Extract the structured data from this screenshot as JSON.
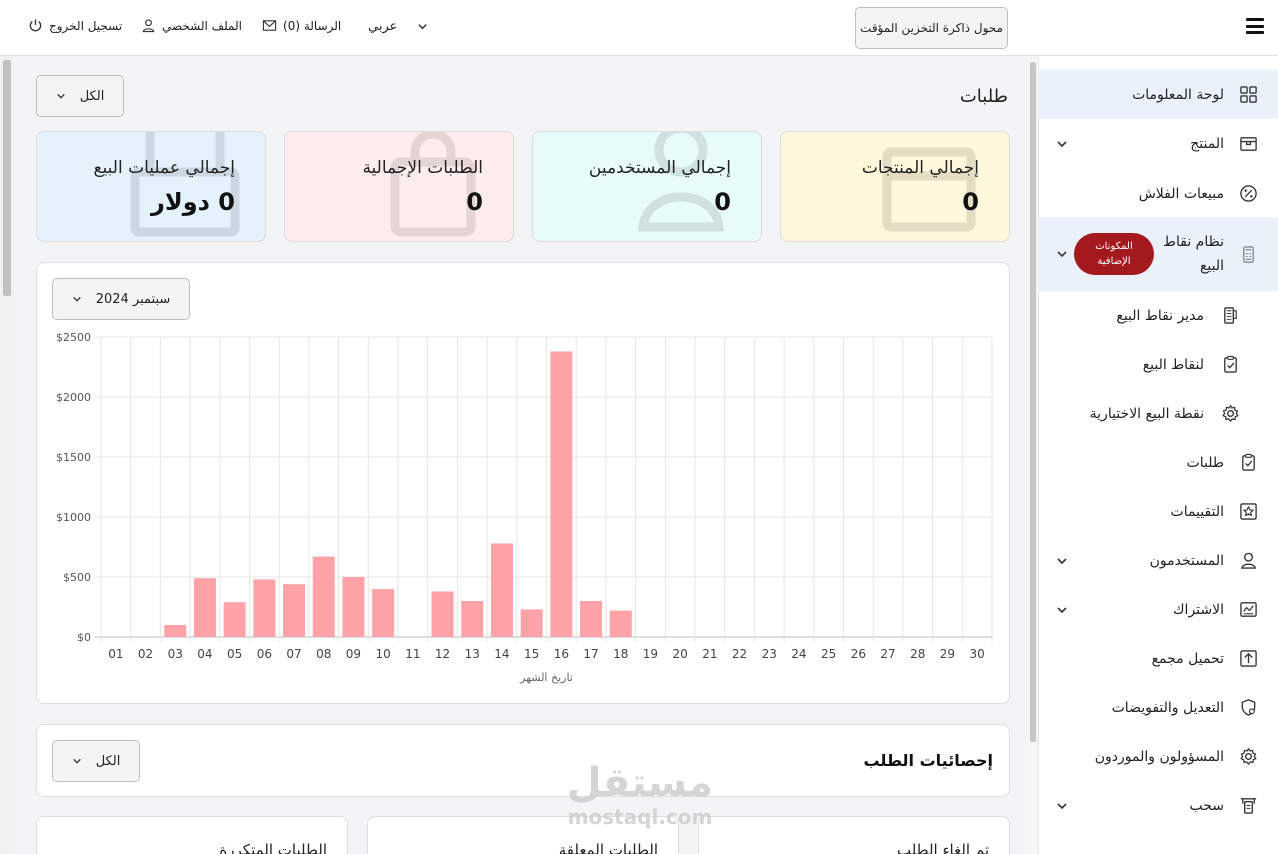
{
  "header": {
    "cache_button": "محول ذاكرة التخزين المؤقت",
    "language": "عربي",
    "messages": "الرسالة (0)",
    "profile": "الملف الشخصي",
    "logout": "تسجيل الخروج"
  },
  "sidebar": {
    "items": [
      {
        "label": "لوحة المعلومات",
        "icon": "dashboard-icon"
      },
      {
        "label": "المنتج",
        "icon": "box-icon"
      },
      {
        "label": "مبيعات الفلاش",
        "icon": "percent-icon"
      },
      {
        "label": "نظام نقاط البيع",
        "icon": "pos-terminal-icon",
        "badge": "المكونات الإضافية"
      },
      {
        "label": "مدير نقاط البيع",
        "icon": "pos-device-icon"
      },
      {
        "label": "لنقاط البيع",
        "icon": "clipboard-check-icon"
      },
      {
        "label": "نقطة البيع الاختيارية",
        "icon": "gear-icon"
      },
      {
        "label": "طلبات",
        "icon": "clipboard-check-icon"
      },
      {
        "label": "التقييمات",
        "icon": "star-icon"
      },
      {
        "label": "المستخدمون",
        "icon": "user-icon"
      },
      {
        "label": "الاشتراك",
        "icon": "subscription-icon"
      },
      {
        "label": "تحميل مجمع",
        "icon": "upload-icon"
      },
      {
        "label": "التعديل والتفويضات",
        "icon": "shield-icon"
      },
      {
        "label": "المسؤولون والموردون",
        "icon": "gear-icon"
      },
      {
        "label": "سحب",
        "icon": "withdraw-icon"
      }
    ]
  },
  "main": {
    "title": "طلبات",
    "filter": "الكل",
    "cards": [
      {
        "title": "إجمالي المنتجات",
        "value": "0",
        "bg": "#fff8dc"
      },
      {
        "title": "إجمالي المستخدمين",
        "value": "0",
        "bg": "#e8fbfb"
      },
      {
        "title": "الطلبات الإجمالية",
        "value": "0",
        "bg": "#ffecec"
      },
      {
        "title": "إجمالي عمليات البيع",
        "value": "0 دولار",
        "bg": "#e3f2fd"
      }
    ],
    "chart_month": "سبتمبر 2024",
    "stats_title": "إحصائيات الطلب",
    "stats_filter": "الكل",
    "bottom_cards": [
      "تم الغاء الطلب",
      "الطلبات المعلقة",
      "الطلبات المتكررة"
    ]
  },
  "watermark": {
    "arabic": "مستقل",
    "latin": "mostaql.com"
  },
  "chart_data": {
    "type": "bar",
    "categories": [
      "01",
      "02",
      "03",
      "04",
      "05",
      "06",
      "07",
      "08",
      "09",
      "10",
      "11",
      "12",
      "13",
      "14",
      "15",
      "16",
      "17",
      "18",
      "19",
      "20",
      "21",
      "22",
      "23",
      "24",
      "25",
      "26",
      "27",
      "28",
      "29",
      "30"
    ],
    "values": [
      0,
      0,
      100,
      490,
      290,
      480,
      440,
      670,
      500,
      400,
      0,
      380,
      300,
      780,
      230,
      2380,
      300,
      220,
      0,
      0,
      0,
      0,
      0,
      0,
      0,
      0,
      0,
      0,
      0,
      0
    ],
    "ylim": [
      0,
      2500
    ],
    "yticks": [
      "$0",
      "$500",
      "$1000",
      "$1500",
      "$2000",
      "$2500"
    ],
    "xlabel": "تاريخ الشهر",
    "ylabel": "",
    "bar_color": "#ffa3a8",
    "grid": true
  }
}
